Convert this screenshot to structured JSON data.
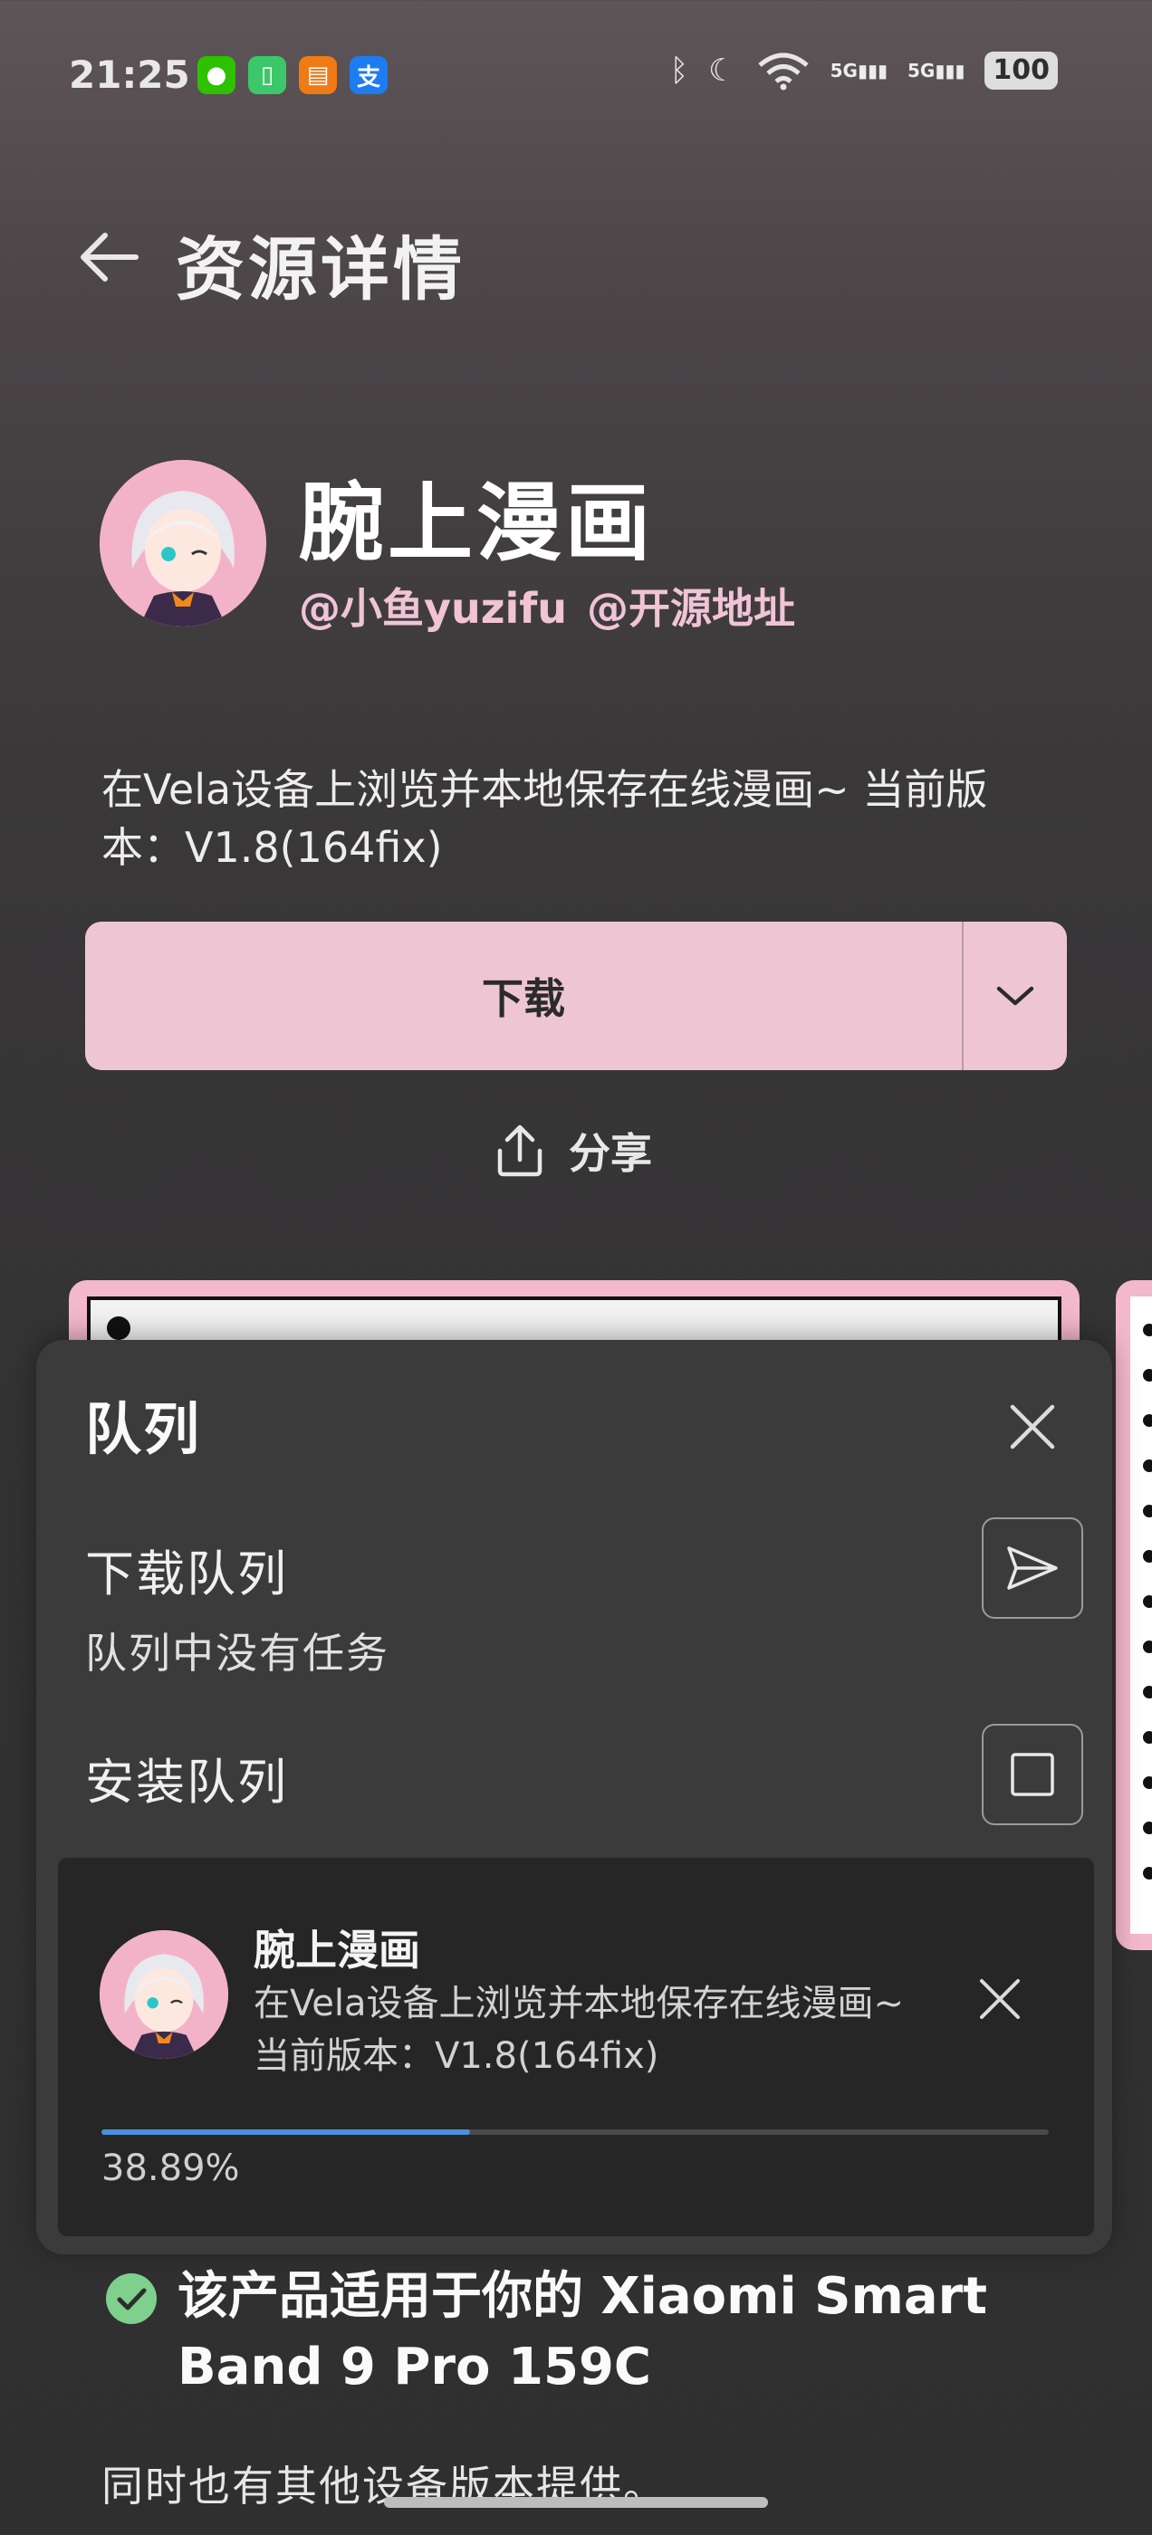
{
  "status_bar": {
    "time": "21:25",
    "apps": [
      {
        "icon": "wechat-icon",
        "color": "#2dc100",
        "glyph": "●"
      },
      {
        "icon": "battery-app-icon",
        "color": "#3cc86a",
        "glyph": "▯"
      },
      {
        "icon": "reader-app-icon",
        "color": "#f07a14",
        "glyph": "▤"
      },
      {
        "icon": "alipay-icon",
        "color": "#1e7cf2",
        "glyph": "支"
      }
    ],
    "signal1": "5G",
    "signal2": "5G",
    "battery": "100"
  },
  "header": {
    "title": "资源详情"
  },
  "app": {
    "name": "腕上漫画",
    "author": "@小鱼yuzifu",
    "source_link": "@开源地址",
    "description": "在Vela设备上浏览并本地保存在线漫画~ 当前版本：V1.8(164fix)"
  },
  "actions": {
    "download": "下载",
    "share": "分享"
  },
  "queue": {
    "title": "队列",
    "download_queue_label": "下载队列",
    "download_queue_empty": "队列中没有任务",
    "install_queue_label": "安装队列",
    "task": {
      "name": "腕上漫画",
      "description": "在Vela设备上浏览并本地保存在线漫画~ 当前版本：V1.8(164fix)",
      "progress_text": "38.89%",
      "progress": 0.3889
    }
  },
  "compat": {
    "message": "该产品适用于你的 Xiaomi Smart Band 9 Pro 159C",
    "other_versions": "同时也有其他设备版本提供。"
  },
  "colors": {
    "accent_pink": "#eec6d3",
    "link_pink": "#f0c4d5",
    "progress_blue": "#4a90d9",
    "check_green": "#7ed08c"
  }
}
